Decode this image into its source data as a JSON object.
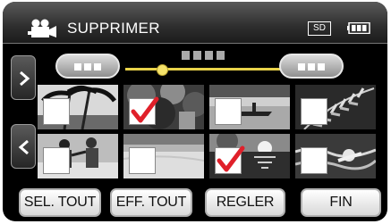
{
  "header": {
    "title": "SUPPRIMER",
    "media_badge": "SD",
    "mode_icon": "video-camera-icon",
    "battery_icon": "battery-icon"
  },
  "navigation": {
    "prev_group_icon": "pill-left-dots",
    "next_group_icon": "pill-right-dots",
    "scroll_position": 0.2,
    "next_page_icon": "chevron-right-icon",
    "prev_page_icon": "chevron-left-icon"
  },
  "thumbnails": [
    {
      "scene": "palms",
      "checked": false
    },
    {
      "scene": "forest",
      "checked": true
    },
    {
      "scene": "lake-boat",
      "checked": false
    },
    {
      "scene": "fern",
      "checked": false
    },
    {
      "scene": "beach-players",
      "checked": false
    },
    {
      "scene": "sandy-beach",
      "checked": false
    },
    {
      "scene": "sunset-sea",
      "checked": true
    },
    {
      "scene": "swimmer",
      "checked": false
    }
  ],
  "buttons": {
    "select_all": "SEL. TOUT",
    "clear_all": "EFF. TOUT",
    "set": "REGLER",
    "end": "FIN"
  },
  "colors": {
    "check_mark": "#e0202a",
    "scroll_track": "#e8d24a",
    "background": "#000000"
  }
}
